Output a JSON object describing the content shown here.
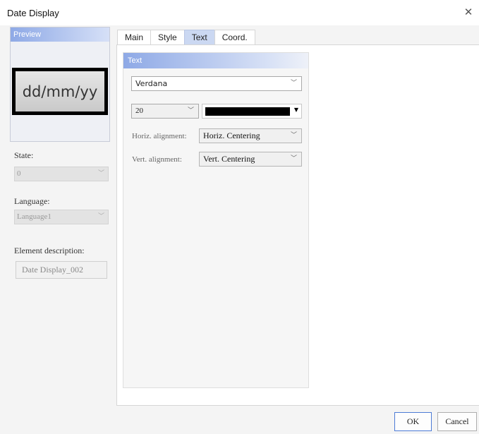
{
  "window": {
    "title": "Date Display"
  },
  "preview": {
    "header": "Preview",
    "display_text": "dd/mm/yy"
  },
  "state": {
    "label": "State:",
    "value": "0"
  },
  "language": {
    "label": "Language:",
    "value": "Language1"
  },
  "element_description": {
    "label": "Element description:",
    "value": "Date Display_002"
  },
  "tabs": [
    {
      "label": "Main",
      "active": false
    },
    {
      "label": "Style",
      "active": false
    },
    {
      "label": "Text",
      "active": true
    },
    {
      "label": "Coord.",
      "active": false
    }
  ],
  "text_group": {
    "header": "Text",
    "font": "Verdana",
    "size": "20",
    "color": "#000000",
    "horiz_label": "Horiz. alignment:",
    "horiz_value": "Horiz. Centering",
    "vert_label": "Vert. alignment:",
    "vert_value": "Vert. Centering"
  },
  "buttons": {
    "ok": "OK",
    "cancel": "Cancel"
  },
  "icons": {
    "close": "close-icon",
    "dropdown": "chevron-down-icon",
    "color_caret": "caret-down-icon"
  }
}
